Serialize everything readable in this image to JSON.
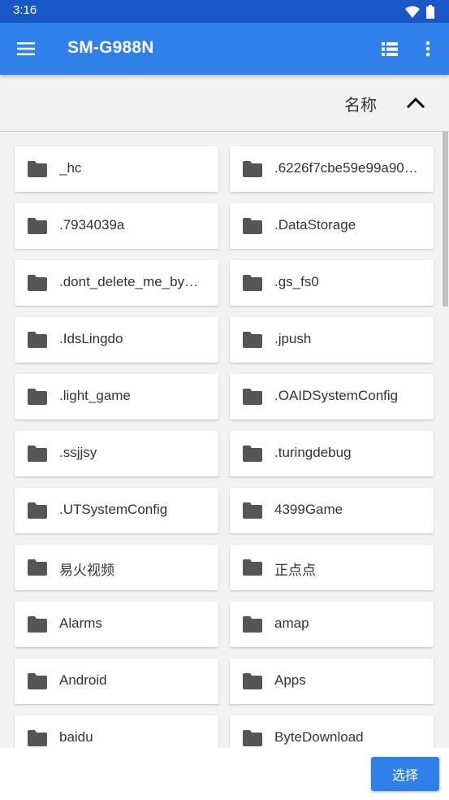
{
  "status_bar": {
    "time": "3:16"
  },
  "app_bar": {
    "title": "SM-G988N"
  },
  "sort_bar": {
    "label": "名称",
    "direction": "ascending"
  },
  "folders": [
    "_hc",
    ".6226f7cbe59e99a90…",
    ".7934039a",
    ".DataStorage",
    ".dont_delete_me_by…",
    ".gs_fs0",
    ".IdsLingdo",
    ".jpush",
    ".light_game",
    ".OAIDSystemConfig",
    ".ssjjsy",
    ".turingdebug",
    ".UTSystemConfig",
    "4399Game",
    "易火视频",
    "正点点",
    "Alarms",
    "amap",
    "Android",
    "Apps",
    "baidu",
    "ByteDownload"
  ],
  "bottom_bar": {
    "select_label": "选择"
  },
  "colors": {
    "status_bar": "#1a57c6",
    "app_bar": "#2f80e8",
    "background": "#f2f2f2",
    "folder_icon": "#555555"
  },
  "icons": [
    "menu-icon",
    "list-view-icon",
    "more-vert-icon",
    "chevron-up-icon",
    "folder-icon",
    "wifi-icon",
    "battery-icon"
  ]
}
